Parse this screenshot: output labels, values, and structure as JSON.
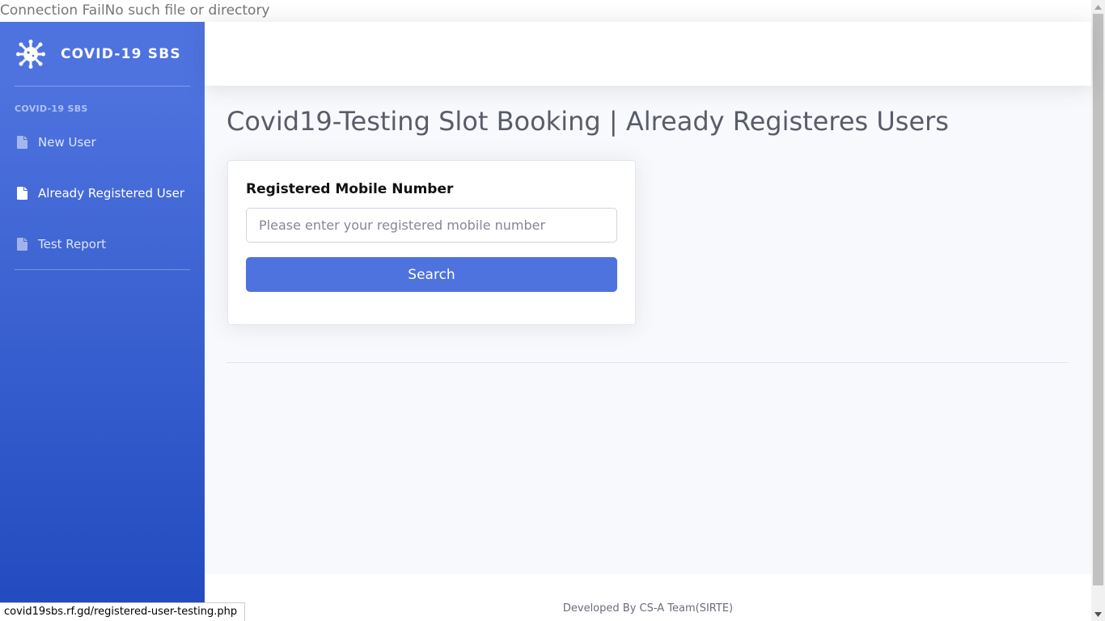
{
  "error_message": "Connection FailNo such file or directory",
  "brand": {
    "title": "COVID-19 SBS",
    "icon": "virus-icon"
  },
  "sidebar": {
    "heading": "COVID-19 SBS",
    "items": [
      {
        "label": "New User",
        "icon": "file-icon",
        "active": false
      },
      {
        "label": "Already Registered User",
        "icon": "file-icon",
        "active": true
      },
      {
        "label": "Test Report",
        "icon": "file-icon",
        "active": false
      }
    ]
  },
  "main": {
    "page_title": "Covid19-Testing Slot Booking | Already Registeres Users",
    "form": {
      "label": "Registered Mobile Number",
      "input_value": "",
      "input_placeholder": "Please enter your registered mobile number",
      "button_label": "Search"
    }
  },
  "footer": {
    "text": "Developed By CS-A Team(SIRTE)"
  },
  "status_bar": {
    "url": "covid19sbs.rf.gd/registered-user-testing.php"
  },
  "colors": {
    "primary": "#4e73df",
    "sidebar_gradient_end": "#224abe",
    "content_bg": "#f8f9fc"
  }
}
